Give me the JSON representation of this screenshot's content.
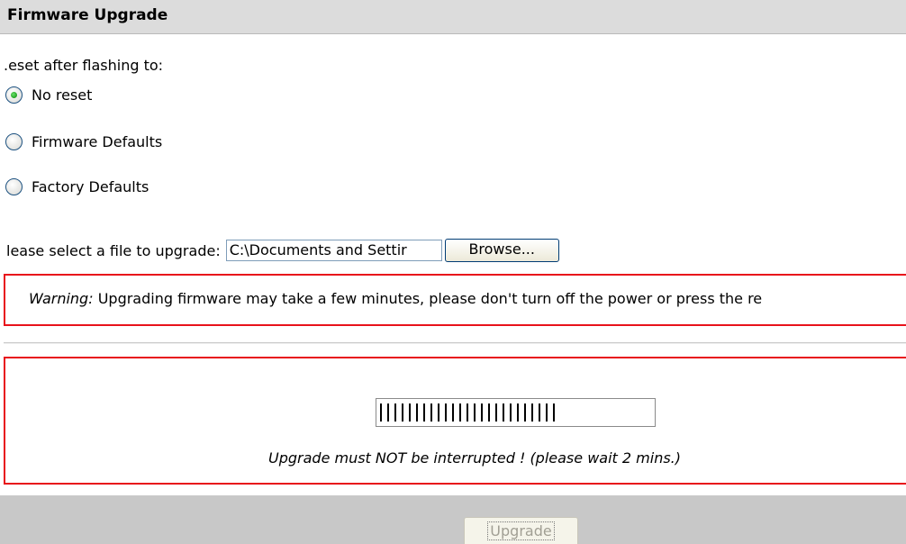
{
  "header": {
    "title": "Firmware Upgrade"
  },
  "reset": {
    "label": ".eset after flashing to:",
    "options": [
      {
        "label": "No reset",
        "checked": true
      },
      {
        "label": "Firmware Defaults",
        "checked": false
      },
      {
        "label": "Factory Defaults",
        "checked": false
      }
    ]
  },
  "file": {
    "label": "lease select a file to upgrade:",
    "value": "C:\\Documents and Settir",
    "browse_label": "Browse..."
  },
  "warning": {
    "prefix": "Warning:",
    "text": " Upgrading firmware may take a few minutes, please don't turn off the power or press the re"
  },
  "progress": {
    "bars_text": "",
    "fraction": 0.66,
    "note": "Upgrade must NOT be interrupted ! (please wait 2 mins.)"
  },
  "footer": {
    "upgrade_label": "Upgrade"
  }
}
